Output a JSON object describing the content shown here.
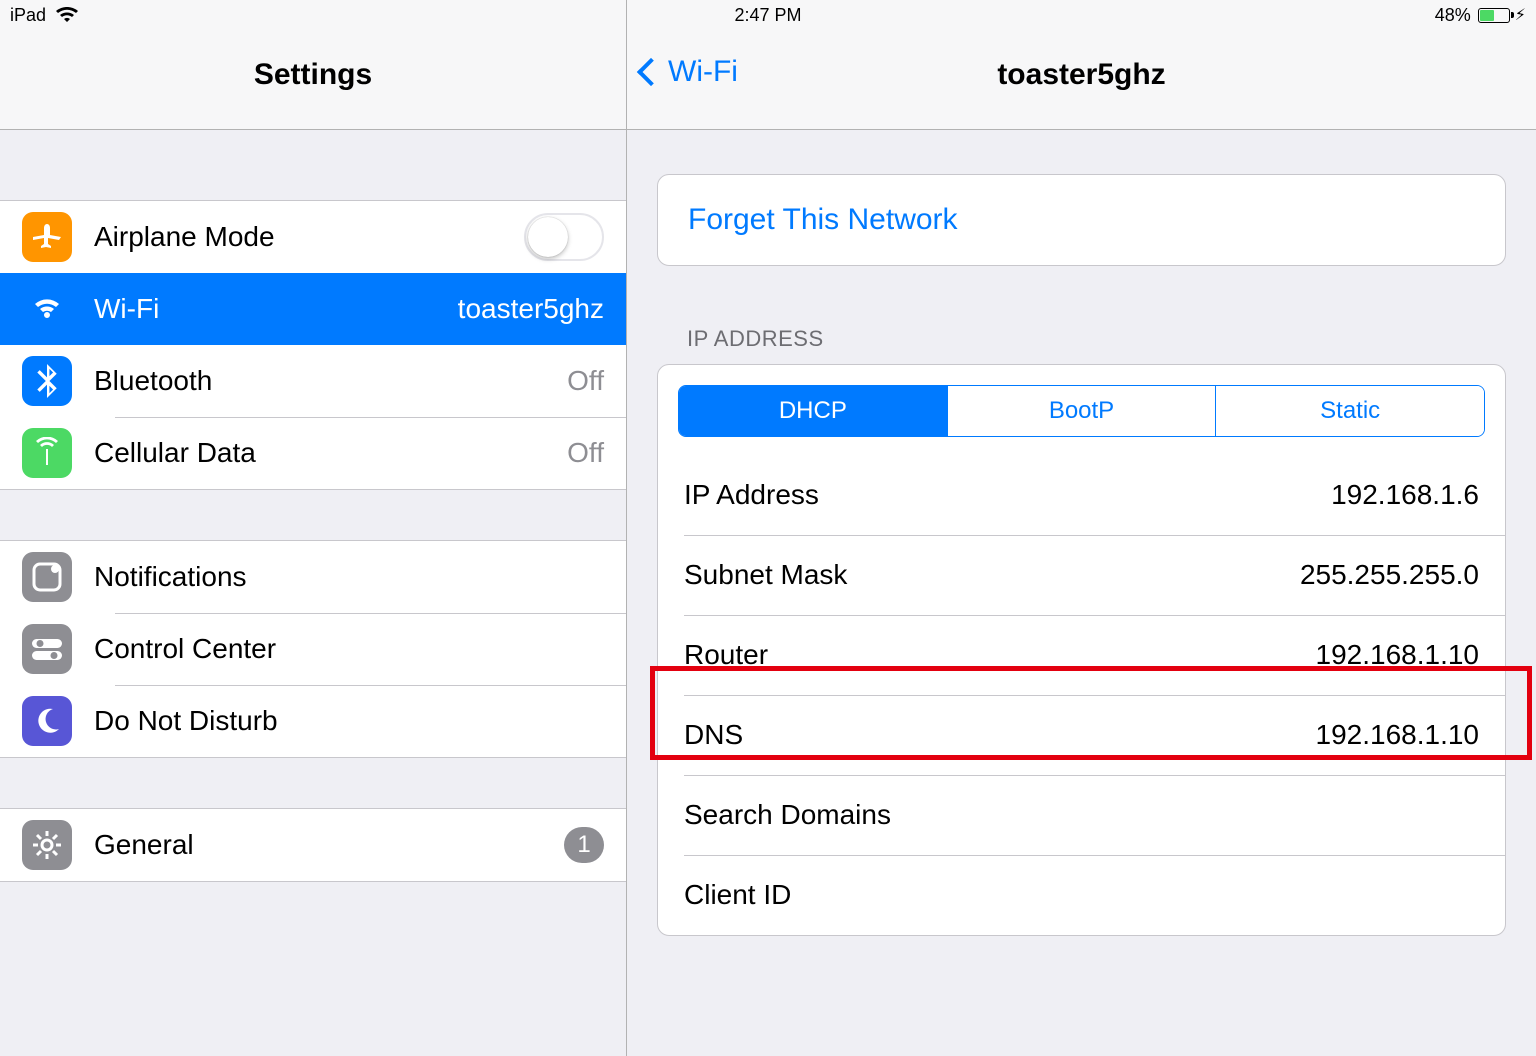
{
  "status": {
    "device": "iPad",
    "time": "2:47 PM",
    "battery_pct": "48%"
  },
  "left": {
    "title": "Settings",
    "group_connect": {
      "airplane": {
        "label": "Airplane Mode"
      },
      "wifi": {
        "label": "Wi-Fi",
        "value": "toaster5ghz"
      },
      "bluetooth": {
        "label": "Bluetooth",
        "value": "Off"
      },
      "cellular": {
        "label": "Cellular Data",
        "value": "Off"
      }
    },
    "group_system": {
      "notifications": {
        "label": "Notifications"
      },
      "control_center": {
        "label": "Control Center"
      },
      "dnd": {
        "label": "Do Not Disturb"
      }
    },
    "group_general": {
      "general": {
        "label": "General",
        "badge": "1"
      }
    }
  },
  "right": {
    "back_label": "Wi-Fi",
    "title": "toaster5ghz",
    "forget_label": "Forget This Network",
    "section_header": "IP Address",
    "segments": [
      "DHCP",
      "BootP",
      "Static"
    ],
    "segment_active": 0,
    "rows": {
      "ip": {
        "label": "IP Address",
        "value": "192.168.1.6"
      },
      "subnet": {
        "label": "Subnet Mask",
        "value": "255.255.255.0"
      },
      "router": {
        "label": "Router",
        "value": "192.168.1.10"
      },
      "dns": {
        "label": "DNS",
        "value": "192.168.1.10"
      },
      "search": {
        "label": "Search Domains",
        "value": ""
      },
      "client": {
        "label": "Client ID",
        "value": ""
      }
    }
  },
  "colors": {
    "accent": "#007aff",
    "orange": "#ff9500",
    "blue": "#007aff",
    "green": "#4cd964",
    "gray": "#8e8e93",
    "purple": "#5856d6"
  }
}
